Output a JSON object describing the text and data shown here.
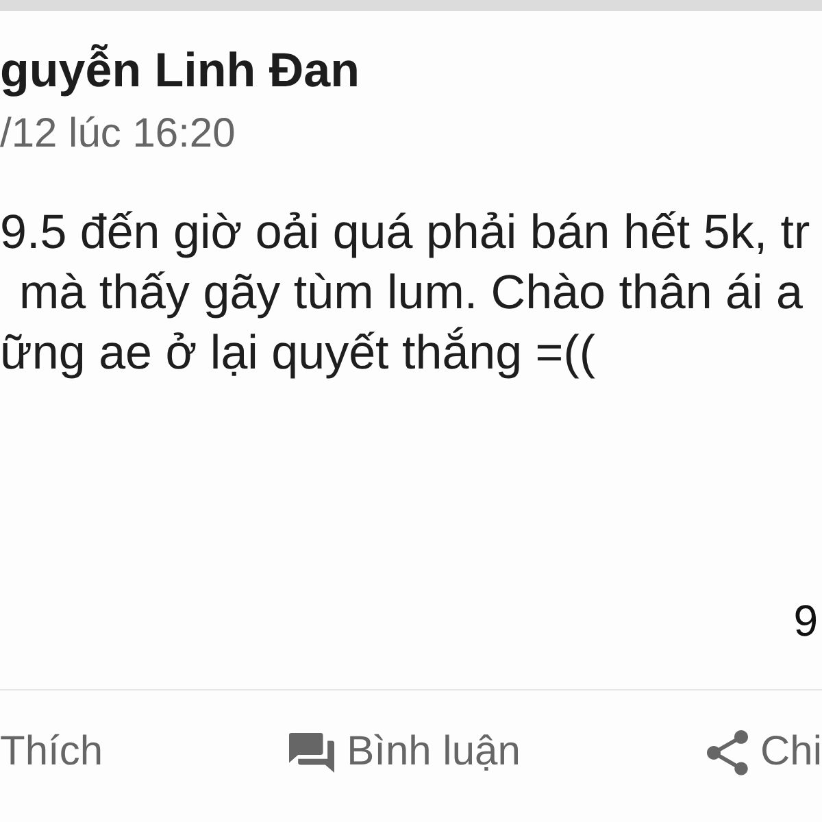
{
  "post": {
    "author": "guyễn Linh Đan",
    "timestamp": "/12 lúc 16:20",
    "body_lines": [
      "9.5 đến giờ oải quá phải bán hết 5k, tr",
      "mà thấy gãy tùm lum. Chào thân ái a",
      "ững ae ở lại quyết thắng =(("
    ],
    "count": "9"
  },
  "actions": [
    {
      "kind": "like",
      "label": "Thích"
    },
    {
      "kind": "comment",
      "label": "Bình luận"
    },
    {
      "kind": "share",
      "label": "Chi"
    }
  ]
}
